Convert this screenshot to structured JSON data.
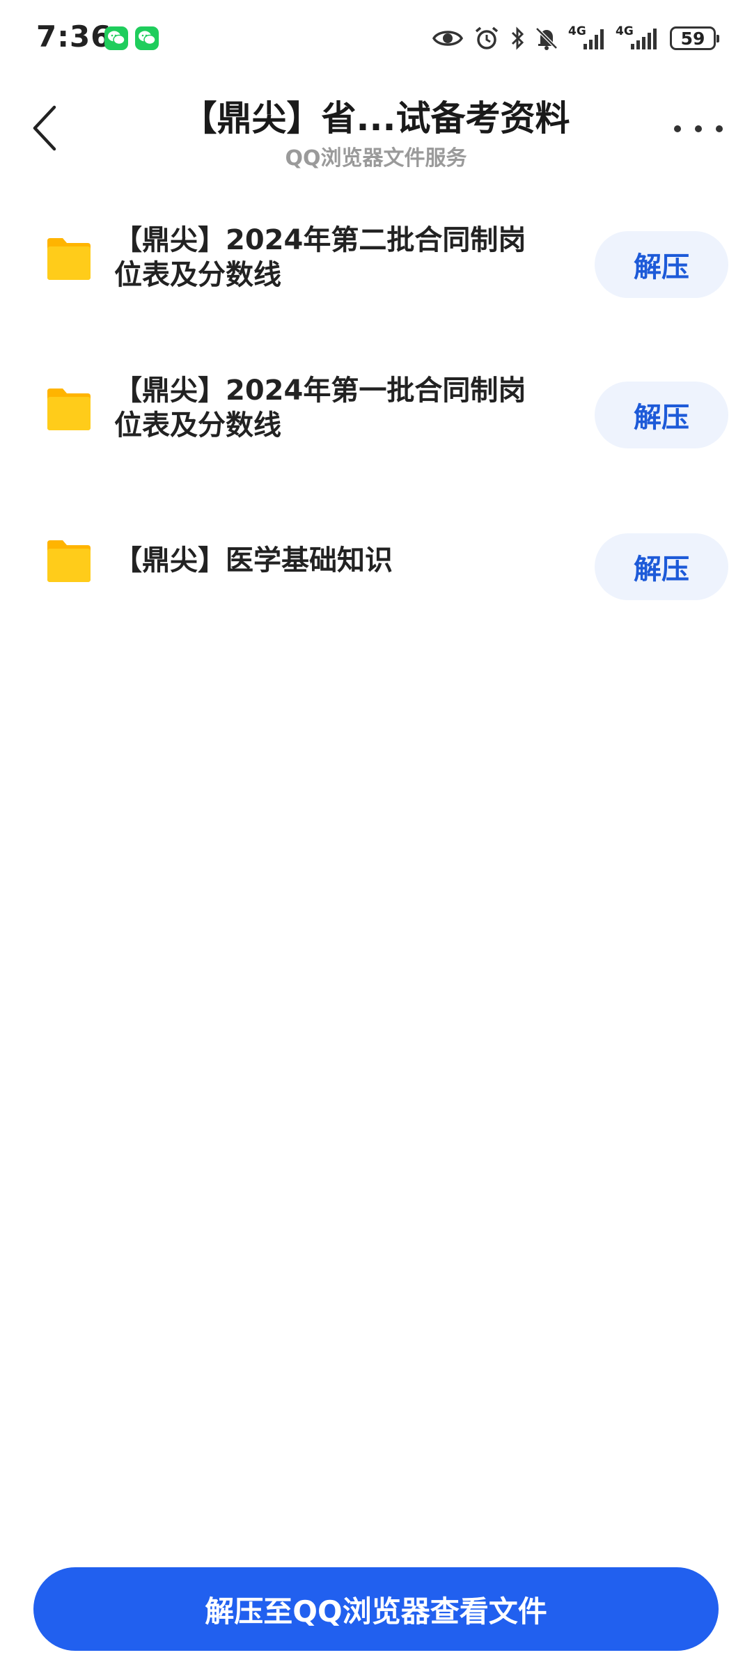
{
  "status_bar": {
    "time": "7:36",
    "notifications": [
      "wechat-icon",
      "wechat-icon"
    ],
    "icons": [
      "eye-icon",
      "alarm-icon",
      "bluetooth-icon",
      "mute-bell-icon",
      "signal-4g-icon",
      "signal-4g-icon"
    ],
    "network_1": "4G",
    "network_2": "4G",
    "battery": "59"
  },
  "header": {
    "title": "【鼎尖】省...试备考资料",
    "subtitle": "QQ浏览器文件服务",
    "back_icon": "chevron-left-icon",
    "more_icon": "more-horizontal-icon"
  },
  "files": [
    {
      "icon": "folder-icon",
      "name_line1": "【鼎尖】2024年第二批合同制岗",
      "name_line2": "位表及分数线",
      "action": "解压"
    },
    {
      "icon": "folder-icon",
      "name_line1": "【鼎尖】2024年第一批合同制岗",
      "name_line2": "位表及分数线",
      "action": "解压"
    },
    {
      "icon": "folder-icon",
      "name_line1": "【鼎尖】医学基础知识",
      "action": "解压"
    }
  ],
  "primary_action": "解压至QQ浏览器查看文件",
  "colors": {
    "accent": "#2160ef",
    "accent_text": "#1d5ad8",
    "action_bg": "#eef3fd",
    "folder": "#ffc107",
    "wechat": "#1fcd5c",
    "subtitle": "#9a9a9a"
  }
}
